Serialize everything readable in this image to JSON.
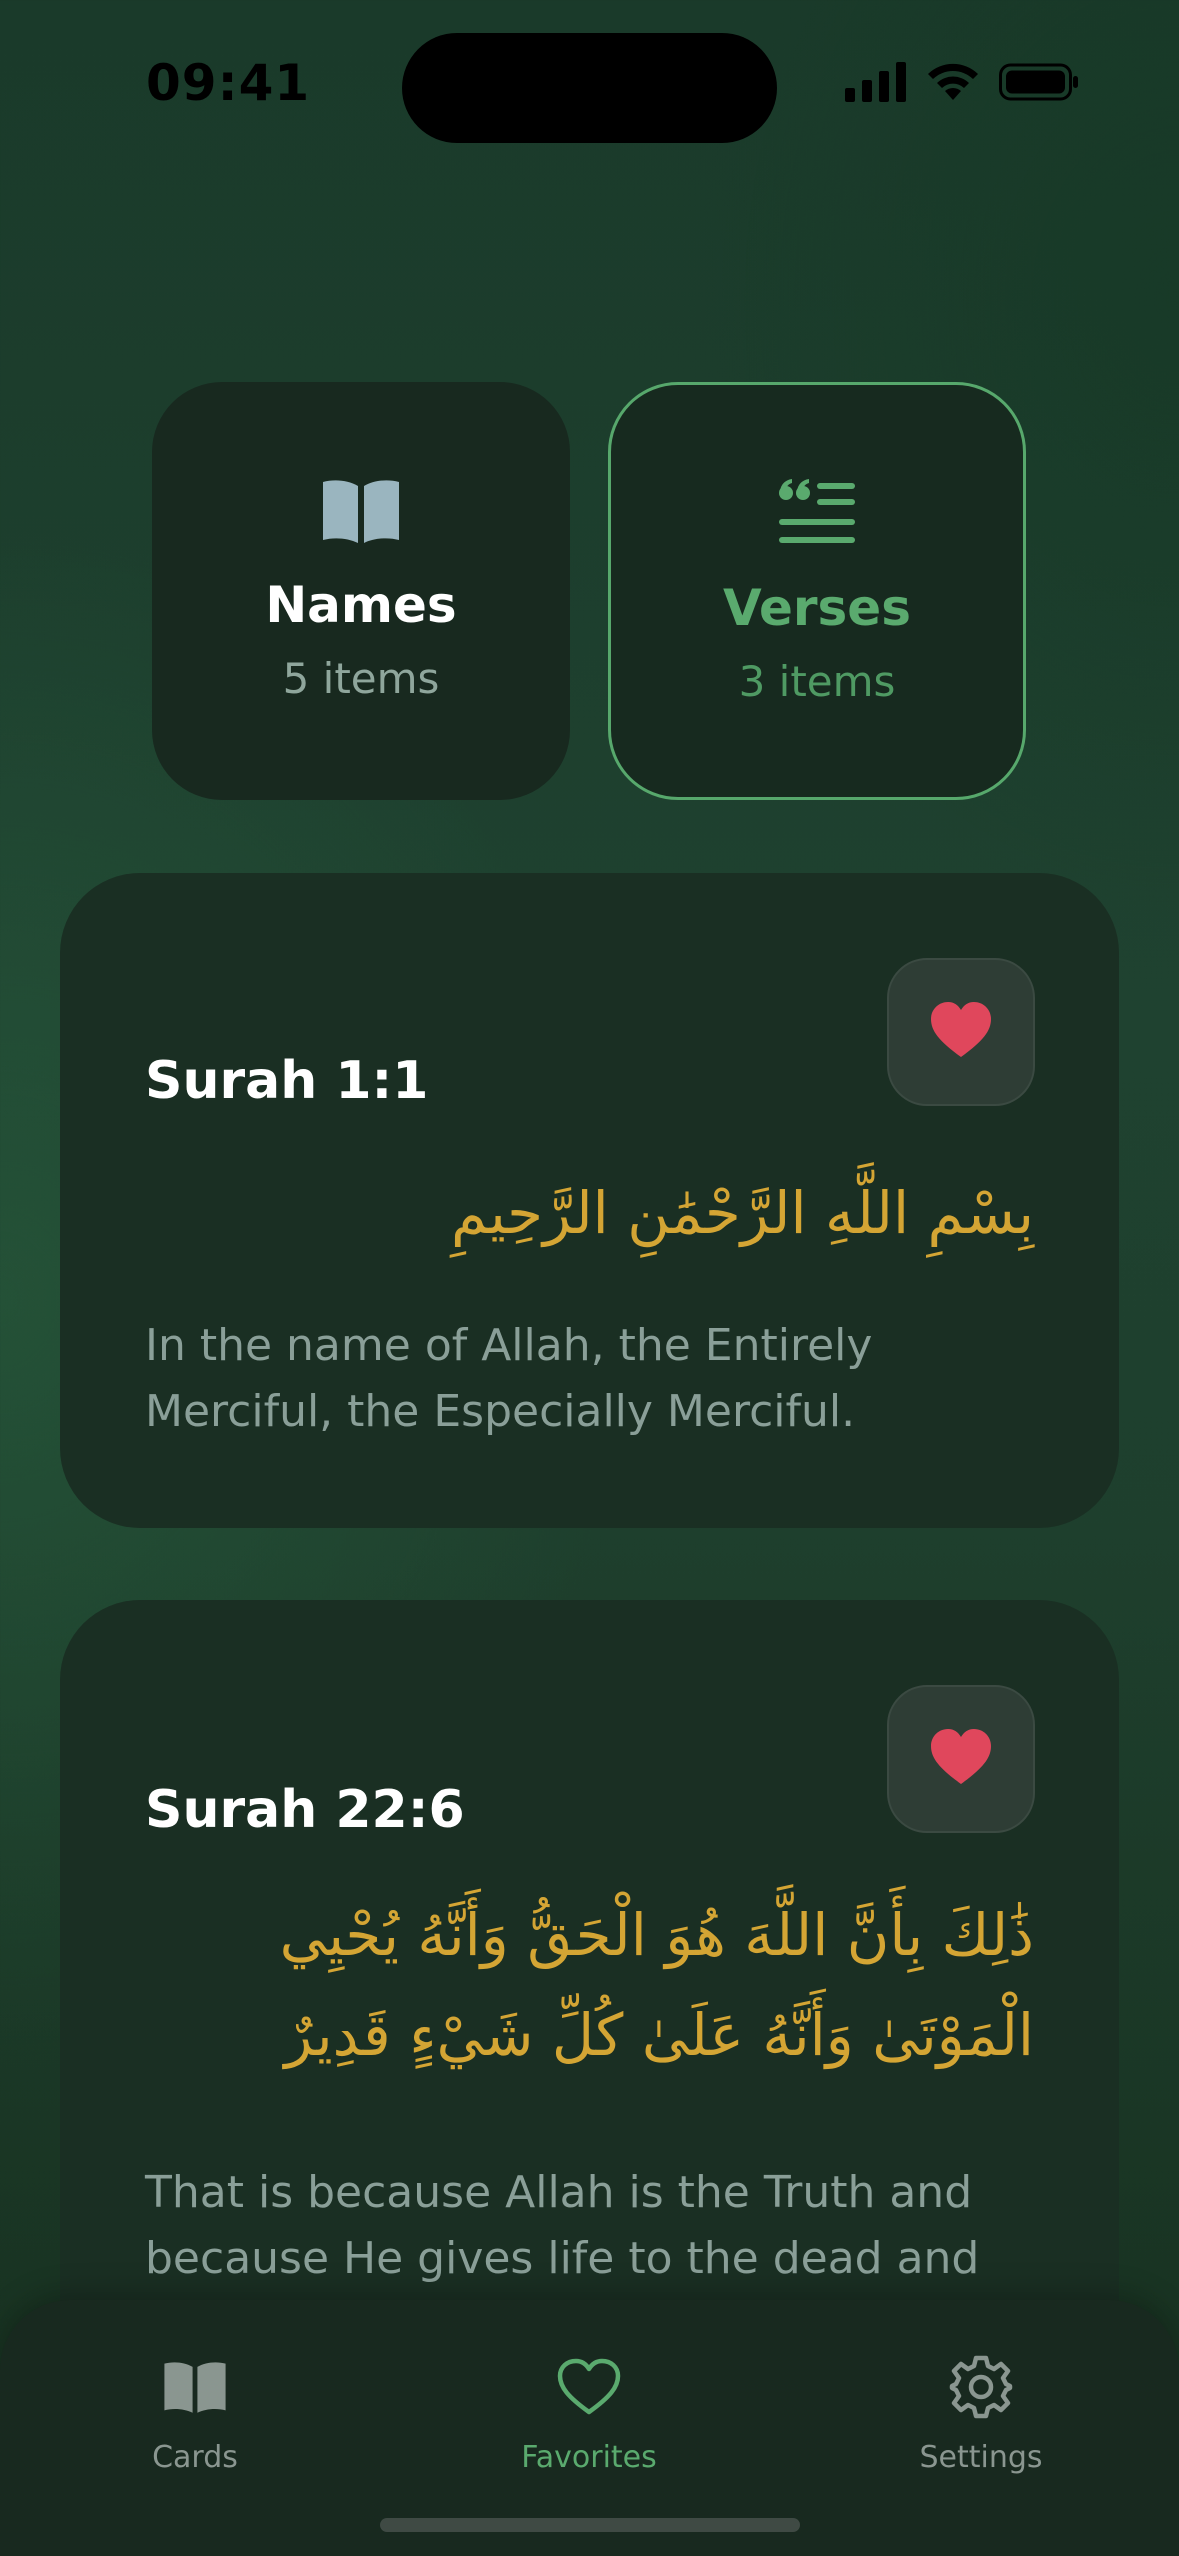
{
  "status_bar": {
    "time": "09:41"
  },
  "categories": [
    {
      "title": "Names",
      "count": "5 items",
      "icon": "book-open-icon",
      "selected": false
    },
    {
      "title": "Verses",
      "count": "3 items",
      "icon": "quote-lines-icon",
      "selected": true
    }
  ],
  "verses": [
    {
      "reference": "Surah 1:1",
      "arabic": "بِسْمِ اللَّهِ الرَّحْمَٰنِ الرَّحِيمِ",
      "translation": "In the name of Allah, the Entirely Merciful, the Especially Merciful.",
      "favorited": true
    },
    {
      "reference": "Surah 22:6",
      "arabic": "ذَٰلِكَ بِأَنَّ اللَّهَ هُوَ الْحَقُّ وَأَنَّهُ يُحْيِي الْمَوْتَىٰ وَأَنَّهُ عَلَىٰ كُلِّ شَيْءٍ قَدِيرٌ",
      "translation": "That is because Allah is the Truth and because He gives life to the dead and",
      "favorited": true
    }
  ],
  "tab_bar": {
    "tabs": [
      {
        "label": "Cards",
        "icon": "book-open-icon"
      },
      {
        "label": "Favorites",
        "icon": "heart-outline-icon",
        "active": true
      },
      {
        "label": "Settings",
        "icon": "gear-icon"
      }
    ]
  },
  "colors": {
    "accent_green": "#5aaa6e",
    "arabic_gold": "#d4a534",
    "heart_red": "#e0475c",
    "card_bg": "#1a2f23"
  }
}
